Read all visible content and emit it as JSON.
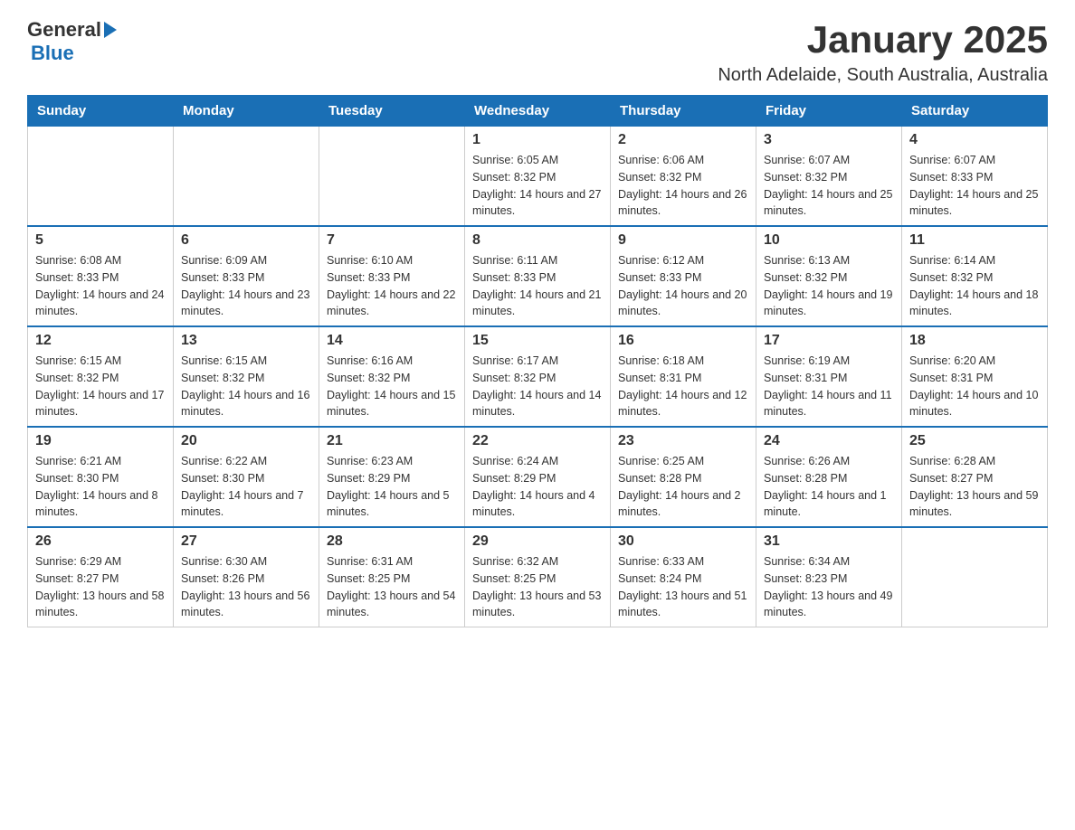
{
  "header": {
    "logo_general": "General",
    "logo_blue": "Blue",
    "title": "January 2025",
    "subtitle": "North Adelaide, South Australia, Australia"
  },
  "days_of_week": [
    "Sunday",
    "Monday",
    "Tuesday",
    "Wednesday",
    "Thursday",
    "Friday",
    "Saturday"
  ],
  "weeks": [
    [
      {
        "day": "",
        "info": ""
      },
      {
        "day": "",
        "info": ""
      },
      {
        "day": "",
        "info": ""
      },
      {
        "day": "1",
        "info": "Sunrise: 6:05 AM\nSunset: 8:32 PM\nDaylight: 14 hours and 27 minutes."
      },
      {
        "day": "2",
        "info": "Sunrise: 6:06 AM\nSunset: 8:32 PM\nDaylight: 14 hours and 26 minutes."
      },
      {
        "day": "3",
        "info": "Sunrise: 6:07 AM\nSunset: 8:32 PM\nDaylight: 14 hours and 25 minutes."
      },
      {
        "day": "4",
        "info": "Sunrise: 6:07 AM\nSunset: 8:33 PM\nDaylight: 14 hours and 25 minutes."
      }
    ],
    [
      {
        "day": "5",
        "info": "Sunrise: 6:08 AM\nSunset: 8:33 PM\nDaylight: 14 hours and 24 minutes."
      },
      {
        "day": "6",
        "info": "Sunrise: 6:09 AM\nSunset: 8:33 PM\nDaylight: 14 hours and 23 minutes."
      },
      {
        "day": "7",
        "info": "Sunrise: 6:10 AM\nSunset: 8:33 PM\nDaylight: 14 hours and 22 minutes."
      },
      {
        "day": "8",
        "info": "Sunrise: 6:11 AM\nSunset: 8:33 PM\nDaylight: 14 hours and 21 minutes."
      },
      {
        "day": "9",
        "info": "Sunrise: 6:12 AM\nSunset: 8:33 PM\nDaylight: 14 hours and 20 minutes."
      },
      {
        "day": "10",
        "info": "Sunrise: 6:13 AM\nSunset: 8:32 PM\nDaylight: 14 hours and 19 minutes."
      },
      {
        "day": "11",
        "info": "Sunrise: 6:14 AM\nSunset: 8:32 PM\nDaylight: 14 hours and 18 minutes."
      }
    ],
    [
      {
        "day": "12",
        "info": "Sunrise: 6:15 AM\nSunset: 8:32 PM\nDaylight: 14 hours and 17 minutes."
      },
      {
        "day": "13",
        "info": "Sunrise: 6:15 AM\nSunset: 8:32 PM\nDaylight: 14 hours and 16 minutes."
      },
      {
        "day": "14",
        "info": "Sunrise: 6:16 AM\nSunset: 8:32 PM\nDaylight: 14 hours and 15 minutes."
      },
      {
        "day": "15",
        "info": "Sunrise: 6:17 AM\nSunset: 8:32 PM\nDaylight: 14 hours and 14 minutes."
      },
      {
        "day": "16",
        "info": "Sunrise: 6:18 AM\nSunset: 8:31 PM\nDaylight: 14 hours and 12 minutes."
      },
      {
        "day": "17",
        "info": "Sunrise: 6:19 AM\nSunset: 8:31 PM\nDaylight: 14 hours and 11 minutes."
      },
      {
        "day": "18",
        "info": "Sunrise: 6:20 AM\nSunset: 8:31 PM\nDaylight: 14 hours and 10 minutes."
      }
    ],
    [
      {
        "day": "19",
        "info": "Sunrise: 6:21 AM\nSunset: 8:30 PM\nDaylight: 14 hours and 8 minutes."
      },
      {
        "day": "20",
        "info": "Sunrise: 6:22 AM\nSunset: 8:30 PM\nDaylight: 14 hours and 7 minutes."
      },
      {
        "day": "21",
        "info": "Sunrise: 6:23 AM\nSunset: 8:29 PM\nDaylight: 14 hours and 5 minutes."
      },
      {
        "day": "22",
        "info": "Sunrise: 6:24 AM\nSunset: 8:29 PM\nDaylight: 14 hours and 4 minutes."
      },
      {
        "day": "23",
        "info": "Sunrise: 6:25 AM\nSunset: 8:28 PM\nDaylight: 14 hours and 2 minutes."
      },
      {
        "day": "24",
        "info": "Sunrise: 6:26 AM\nSunset: 8:28 PM\nDaylight: 14 hours and 1 minute."
      },
      {
        "day": "25",
        "info": "Sunrise: 6:28 AM\nSunset: 8:27 PM\nDaylight: 13 hours and 59 minutes."
      }
    ],
    [
      {
        "day": "26",
        "info": "Sunrise: 6:29 AM\nSunset: 8:27 PM\nDaylight: 13 hours and 58 minutes."
      },
      {
        "day": "27",
        "info": "Sunrise: 6:30 AM\nSunset: 8:26 PM\nDaylight: 13 hours and 56 minutes."
      },
      {
        "day": "28",
        "info": "Sunrise: 6:31 AM\nSunset: 8:25 PM\nDaylight: 13 hours and 54 minutes."
      },
      {
        "day": "29",
        "info": "Sunrise: 6:32 AM\nSunset: 8:25 PM\nDaylight: 13 hours and 53 minutes."
      },
      {
        "day": "30",
        "info": "Sunrise: 6:33 AM\nSunset: 8:24 PM\nDaylight: 13 hours and 51 minutes."
      },
      {
        "day": "31",
        "info": "Sunrise: 6:34 AM\nSunset: 8:23 PM\nDaylight: 13 hours and 49 minutes."
      },
      {
        "day": "",
        "info": ""
      }
    ]
  ]
}
